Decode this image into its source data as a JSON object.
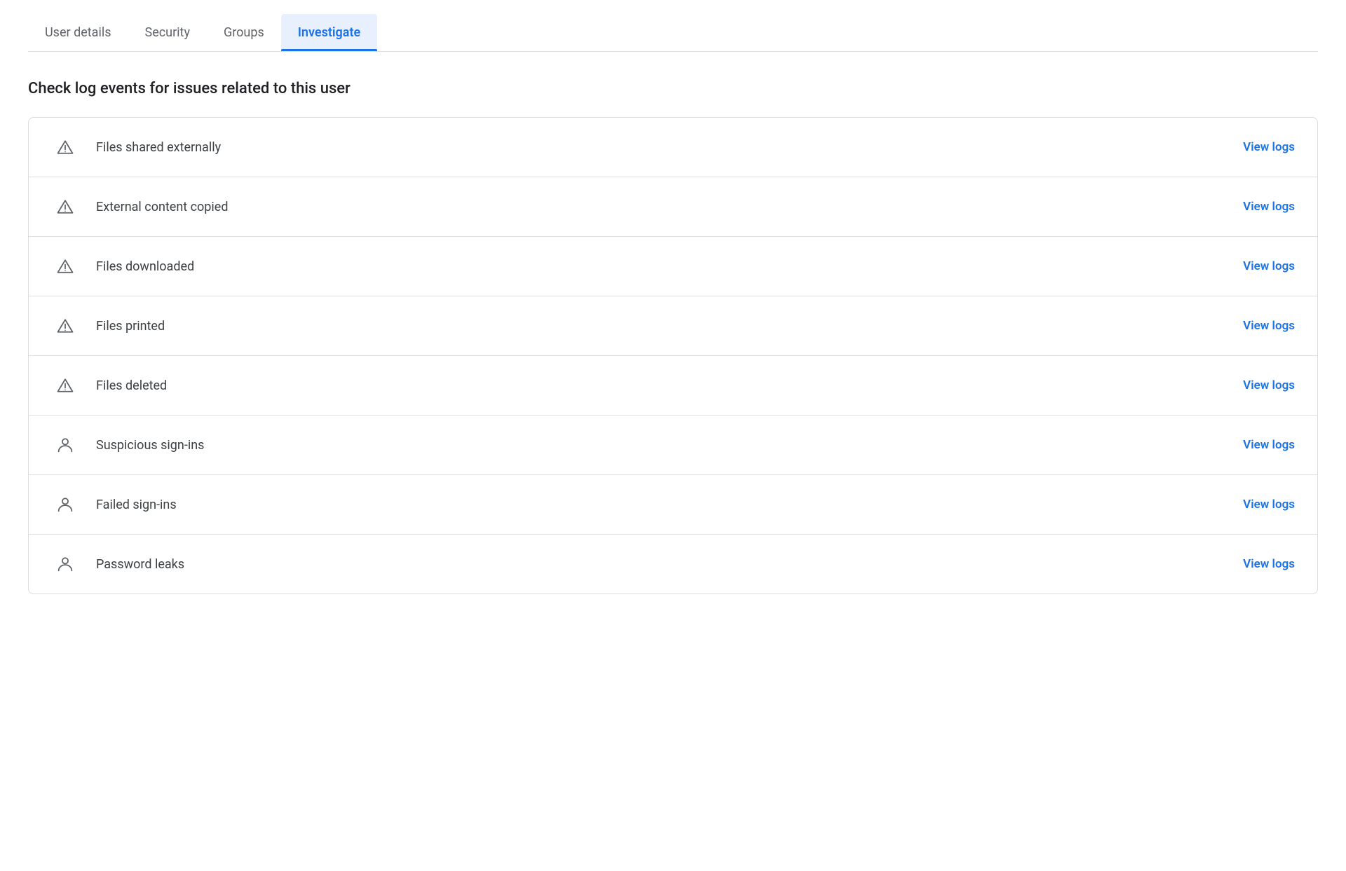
{
  "tabs": [
    {
      "id": "user-details",
      "label": "User details",
      "active": false
    },
    {
      "id": "security",
      "label": "Security",
      "active": false
    },
    {
      "id": "groups",
      "label": "Groups",
      "active": false
    },
    {
      "id": "investigate",
      "label": "Investigate",
      "active": true
    }
  ],
  "section": {
    "title": "Check log events for issues related to this user"
  },
  "log_items": [
    {
      "id": "files-shared-externally",
      "label": "Files shared externally",
      "icon_type": "triangle",
      "view_logs_label": "View logs"
    },
    {
      "id": "external-content-copied",
      "label": "External content copied",
      "icon_type": "triangle",
      "view_logs_label": "View logs"
    },
    {
      "id": "files-downloaded",
      "label": "Files downloaded",
      "icon_type": "triangle",
      "view_logs_label": "View logs"
    },
    {
      "id": "files-printed",
      "label": "Files printed",
      "icon_type": "triangle",
      "view_logs_label": "View logs"
    },
    {
      "id": "files-deleted",
      "label": "Files deleted",
      "icon_type": "triangle",
      "view_logs_label": "View logs"
    },
    {
      "id": "suspicious-sign-ins",
      "label": "Suspicious sign-ins",
      "icon_type": "person",
      "view_logs_label": "View logs"
    },
    {
      "id": "failed-sign-ins",
      "label": "Failed sign-ins",
      "icon_type": "person",
      "view_logs_label": "View logs"
    },
    {
      "id": "password-leaks",
      "label": "Password leaks",
      "icon_type": "person",
      "view_logs_label": "View logs"
    }
  ]
}
